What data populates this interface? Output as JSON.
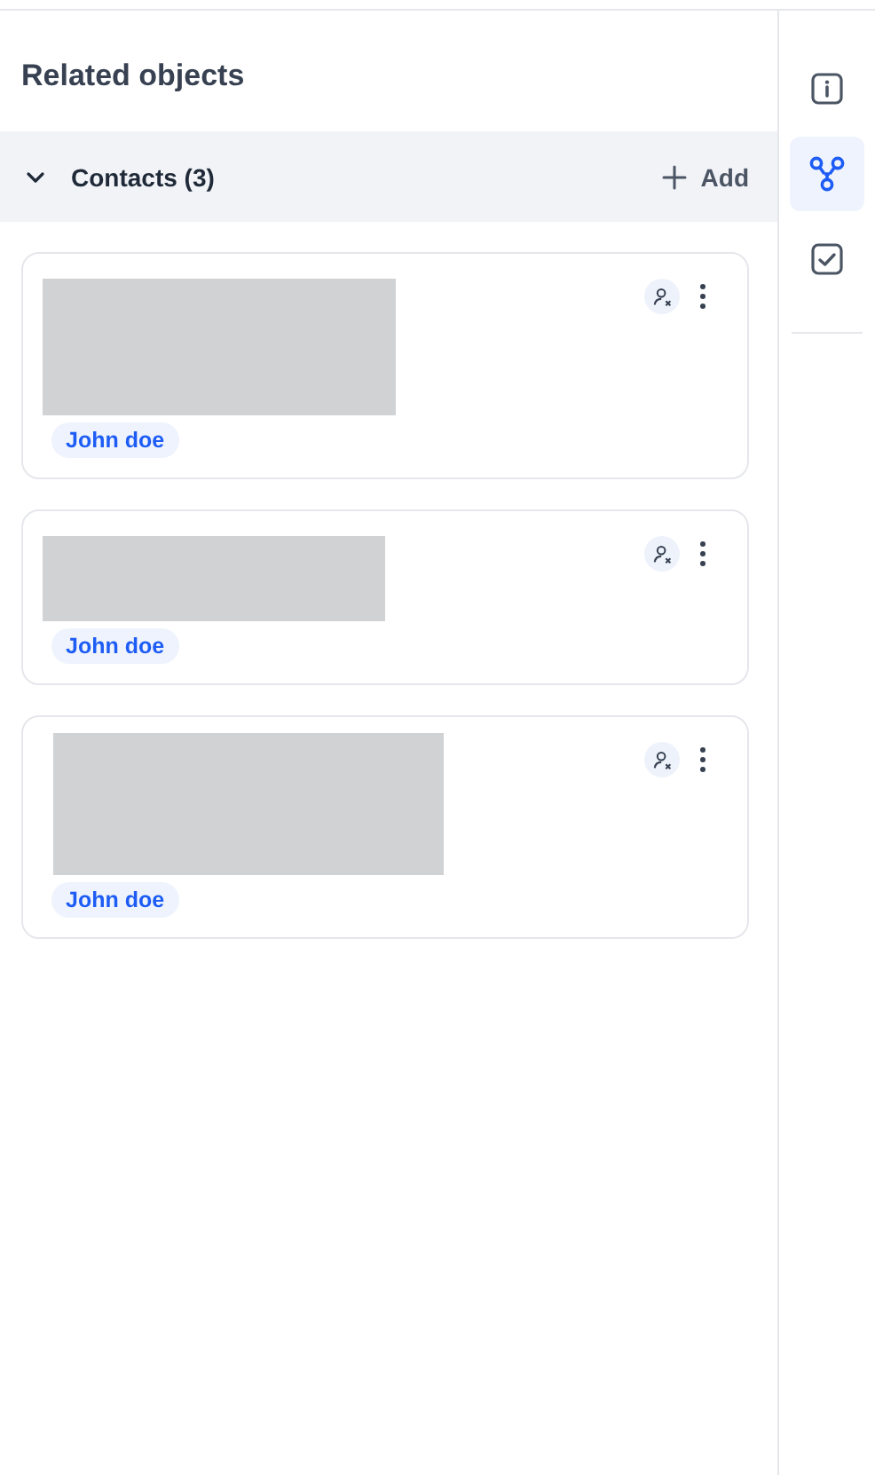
{
  "panel": {
    "title": "Related objects"
  },
  "section": {
    "label": "Contacts (3)",
    "expanded": true,
    "add_label": "Add"
  },
  "contacts": [
    {
      "tag": "John doe"
    },
    {
      "tag": "John doe"
    },
    {
      "tag": "John doe"
    }
  ],
  "side_tabs": [
    {
      "kind": "info",
      "selected": false
    },
    {
      "kind": "relations",
      "selected": true
    },
    {
      "kind": "tasks",
      "selected": false
    }
  ]
}
